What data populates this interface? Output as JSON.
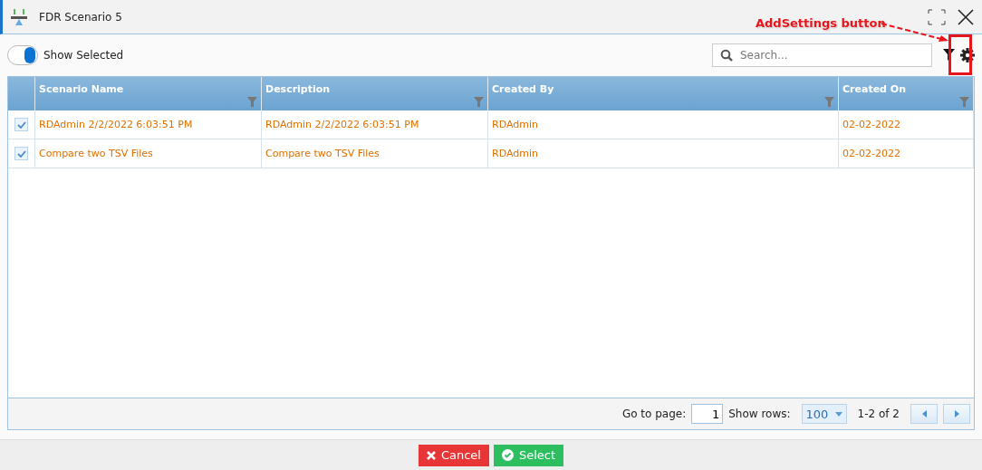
{
  "window": {
    "title": "FDR Scenario 5"
  },
  "toolbar": {
    "show_selected": {
      "label": "Show Selected",
      "on": true
    },
    "search": {
      "placeholder": "Search..."
    }
  },
  "annotation": {
    "text": "AddSettings button"
  },
  "table": {
    "columns": [
      "Scenario Name",
      "Description",
      "Created By",
      "Created On"
    ],
    "rows": [
      {
        "checked": true,
        "cells": [
          "RDAdmin 2/2/2022 6:03:51 PM",
          "RDAdmin 2/2/2022 6:03:51 PM",
          "RDAdmin",
          "02-02-2022"
        ]
      },
      {
        "checked": true,
        "cells": [
          "Compare two TSV Files",
          "Compare two TSV Files",
          "RDAdmin",
          "02-02-2022"
        ]
      }
    ]
  },
  "pager": {
    "goto_label": "Go to page:",
    "page": "1",
    "rows_label": "Show rows:",
    "rows_value": "100",
    "range": "1-2 of 2"
  },
  "buttons": [
    {
      "kind": "cancel",
      "label": "Cancel"
    },
    {
      "kind": "select",
      "label": "Select"
    }
  ]
}
